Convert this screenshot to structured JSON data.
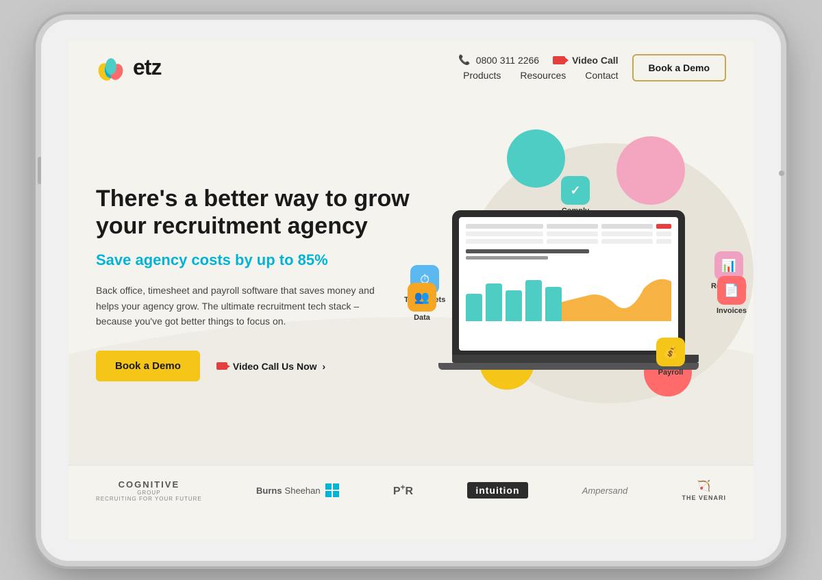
{
  "tablet": {
    "background_color": "#c8c8c8"
  },
  "header": {
    "logo_text": "etz",
    "phone_number": "0800 311 2266",
    "video_call_label": "Video Call",
    "book_demo_label": "Book a Demo",
    "nav_items": [
      {
        "label": "Products",
        "id": "products"
      },
      {
        "label": "Resources",
        "id": "resources"
      },
      {
        "label": "Contact",
        "id": "contact"
      }
    ]
  },
  "hero": {
    "title": "There's a better way to grow your recruitment agency",
    "subtitle": "Save agency costs by up to 85%",
    "description": "Back office, timesheet and payroll software that saves money and helps your agency grow. The ultimate recruitment tech stack – because you've got better things to focus on.",
    "cta_demo": "Book a Demo",
    "cta_video": "Video Call Us Now"
  },
  "features": {
    "bubbles": [
      {
        "id": "comply",
        "label": "Comply",
        "position": "top-center",
        "color": "#4ecdc4",
        "icon": "✓"
      },
      {
        "id": "timesheets",
        "label": "Timesheets",
        "position": "left-mid",
        "color": "#5bb8f0",
        "icon": "⏱"
      },
      {
        "id": "reporting",
        "label": "Reporting",
        "position": "right-top",
        "color": "#f0a0c0",
        "icon": "📊"
      },
      {
        "id": "invoices",
        "label": "Invoices",
        "position": "right-bottom",
        "color": "#ff6b6b",
        "icon": "📄"
      },
      {
        "id": "data",
        "label": "Data",
        "position": "left-bottom",
        "color": "#f5a623",
        "icon": "👥"
      },
      {
        "id": "payroll",
        "label": "Payroll",
        "position": "bottom-right",
        "color": "#f5c518",
        "icon": "💰"
      }
    ]
  },
  "clients": [
    {
      "id": "cognitive",
      "label": "COGNITIVE",
      "sublabel": "RECRUITING FOR YOUR FUTURE"
    },
    {
      "id": "burns-sheehan",
      "label": "BurnsSheehan"
    },
    {
      "id": "psr",
      "label": "P+R"
    },
    {
      "id": "intuition",
      "label": "intuition"
    },
    {
      "id": "ampersand",
      "label": "Ampersand"
    },
    {
      "id": "venari",
      "label": "THE VENARI"
    }
  ]
}
